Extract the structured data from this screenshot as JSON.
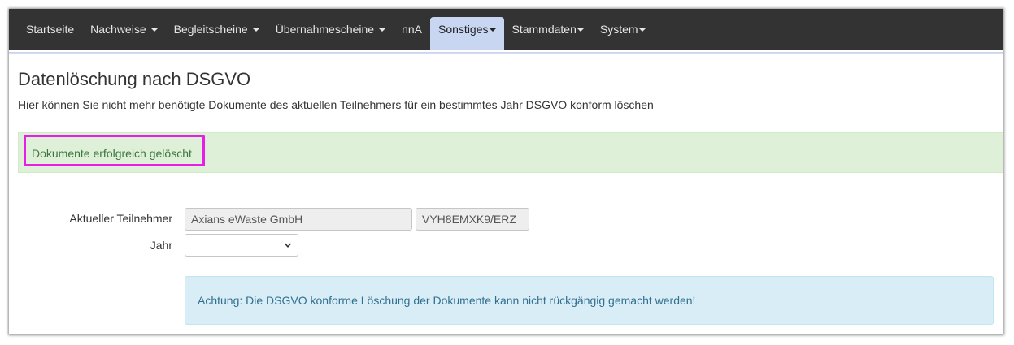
{
  "nav": {
    "items": [
      {
        "label": "Startseite",
        "caret": false,
        "active": false
      },
      {
        "label": "Nachweise",
        "caret": true,
        "active": false
      },
      {
        "label": "Begleitscheine",
        "caret": true,
        "active": false
      },
      {
        "label": "Übernahmescheine",
        "caret": true,
        "active": false
      },
      {
        "label": "nnA",
        "caret": false,
        "active": false
      },
      {
        "label": "Sonstiges",
        "caret": true,
        "active": true
      },
      {
        "label": "Stammdaten",
        "caret": true,
        "active": false
      },
      {
        "label": "System",
        "caret": true,
        "active": false
      }
    ]
  },
  "page": {
    "title": "Datenlöschung nach DSGVO",
    "subtitle": "Hier können Sie nicht mehr benötigte Dokumente des aktuellen Teilnehmers für ein bestimmtes Jahr DSGVO konform löschen"
  },
  "alerts": {
    "success": "Dokumente erfolgreich gelöscht",
    "info": "Achtung: Die DSGVO konforme Löschung der Dokumente kann nicht rückgängig gemacht werden!"
  },
  "form": {
    "teilnehmer_label": "Aktueller Teilnehmer",
    "teilnehmer_name": "Axians eWaste GmbH",
    "teilnehmer_code": "VYH8EMXK9/ERZ",
    "jahr_label": "Jahr",
    "jahr_value": ""
  },
  "colors": {
    "navbar_bg": "#333333",
    "nav_active_bg": "#c9d6f2",
    "success_bg": "#dff0d8",
    "success_text": "#3c763d",
    "info_bg": "#d9edf7",
    "info_text": "#31708f",
    "highlight": "#e61ee6"
  }
}
